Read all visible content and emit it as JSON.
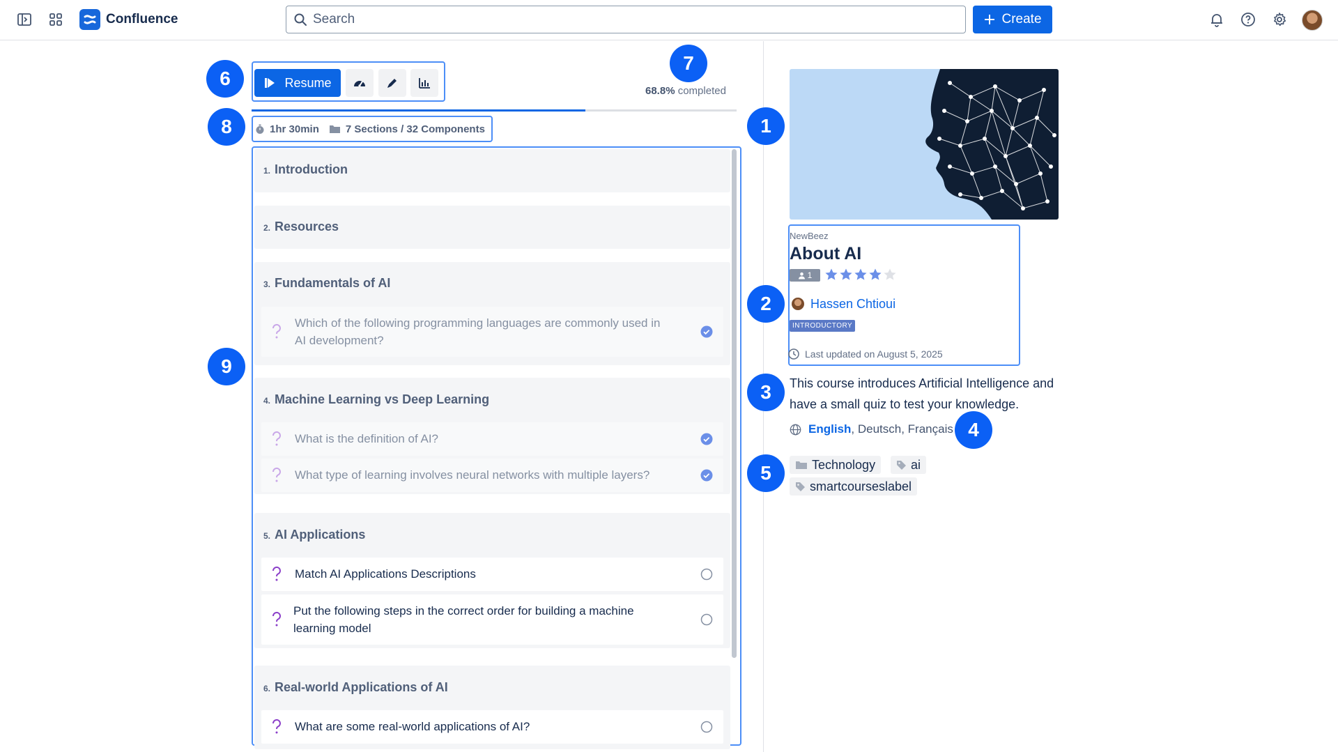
{
  "app": {
    "brand": "Confluence",
    "search_placeholder": "Search",
    "create_label": "Create"
  },
  "markers": [
    "1",
    "2",
    "3",
    "4",
    "5",
    "6",
    "7",
    "8",
    "9"
  ],
  "toolbar": {
    "resume_label": "Resume",
    "progress_value": "68.8%",
    "progress_suffix": "completed",
    "progress_fraction": 0.688
  },
  "meta": {
    "duration": "1hr 30min",
    "structure": "7 Sections / 32 Components"
  },
  "sections": [
    {
      "num": "1.",
      "title": "Introduction",
      "items": []
    },
    {
      "num": "2.",
      "title": "Resources",
      "items": []
    },
    {
      "num": "3.",
      "title": "Fundamentals of AI",
      "items": [
        {
          "line1": "Which of the following programming languages are commonly used in",
          "line2": "AI development?",
          "done": true
        }
      ]
    },
    {
      "num": "4.",
      "title": "Machine Learning vs Deep Learning",
      "items": [
        {
          "line1": "What is the definition of AI?",
          "done": true
        },
        {
          "line1": "What type of learning involves neural networks with multiple layers?",
          "done": true
        }
      ]
    },
    {
      "num": "5.",
      "title": "AI Applications",
      "items": [
        {
          "line1": "Match AI Applications Descriptions",
          "done": false
        },
        {
          "line1": "Put the following steps in the correct order for building a machine",
          "line2": "learning model",
          "done": false
        }
      ]
    },
    {
      "num": "6.",
      "title": "Real-world Applications of AI",
      "items": [
        {
          "line1": "What are some real-world applications of AI?",
          "done": false
        }
      ]
    }
  ],
  "course": {
    "publisher": "NewBeez",
    "title": "About AI",
    "enrolled": "1",
    "rating": 4,
    "rating_max": 5,
    "author": "Hassen Chtioui",
    "level": "INTRODUCTORY",
    "updated": "Last updated on August 5, 2025",
    "description": "This course introduces Artificial Intelligence and have a small quiz to test your knowledge.",
    "languages": {
      "active": "English",
      "others": ", Deutsch, Français"
    },
    "category": "Technology",
    "labels": [
      "ai",
      "smartcourseslabel"
    ]
  },
  "colors": {
    "primary": "#0c66e4",
    "marker": "#0b60f5",
    "highlight_border": "#4c8ef7",
    "hero_bg": "#bcd9f6",
    "hero_figure": "#0f1e33"
  },
  "icons": [
    "sidebar-toggle-icon",
    "app-switcher-icon",
    "confluence-logo-icon",
    "search-icon",
    "plus-icon",
    "bell-icon",
    "help-icon",
    "gear-icon",
    "play-icon",
    "speedometer-icon",
    "pencil-icon",
    "bar-chart-icon",
    "stopwatch-icon",
    "folder-icon",
    "question-icon",
    "check-circle-icon",
    "empty-circle-icon",
    "user-icon",
    "star-icon",
    "clock-icon",
    "globe-icon",
    "tag-icon"
  ]
}
